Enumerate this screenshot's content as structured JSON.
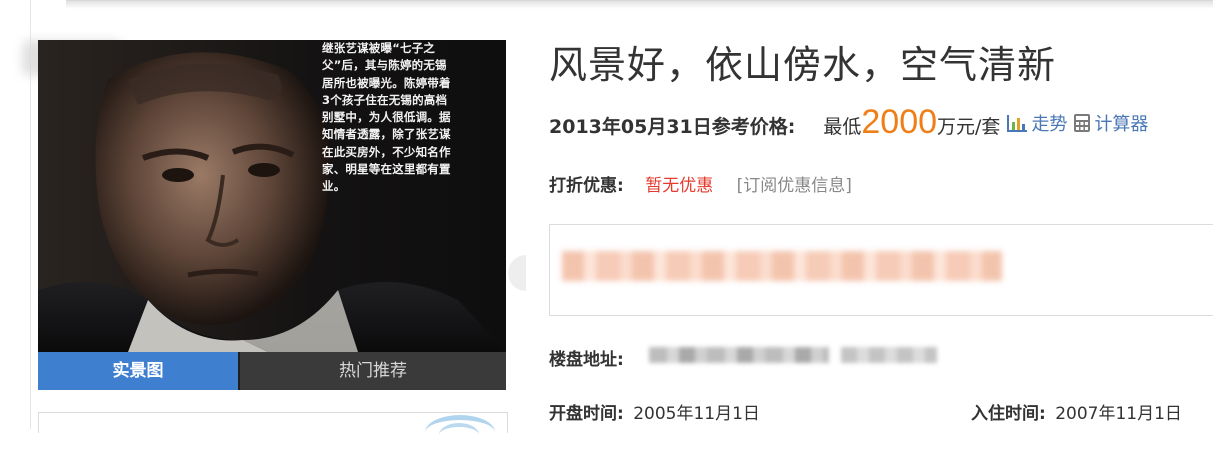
{
  "property": {
    "title": "风景好，依山傍水，空气清新",
    "photo_caption": "继张艺谋被曝“七子之父”后，其与陈婷的无锡居所也被曝光。陈婷带着3个孩子住在无锡的高档别墅中，为人很低调。据知情者透露，除了张艺谋在此买房外，不少知名作家、明星等在这里都有置业。"
  },
  "tabs": [
    {
      "label": "实景图",
      "active": true
    },
    {
      "label": "热门推荐",
      "active": false
    }
  ],
  "price": {
    "label": "2013年05月31日参考价格:",
    "prefix": "最低",
    "value": "2000",
    "unit": "万元/套",
    "trend_label": "走势",
    "trend_icon": "bar-chart-icon",
    "calculator_label": "计算器",
    "calculator_icon": "calculator-icon"
  },
  "discount": {
    "label": "打折优惠:",
    "value": "暂无优惠",
    "subscribe_label": "[订阅优惠信息]"
  },
  "address": {
    "label": "楼盘地址:"
  },
  "dates": {
    "open_label": "开盘时间:",
    "open_value": "2005年11月1日",
    "movein_label": "入住时间:",
    "movein_value": "2007年11月1日"
  },
  "colors": {
    "accent": "#3f7fd0",
    "price": "#f07e17",
    "discount": "#e53a2d",
    "link": "#4a77b5"
  }
}
